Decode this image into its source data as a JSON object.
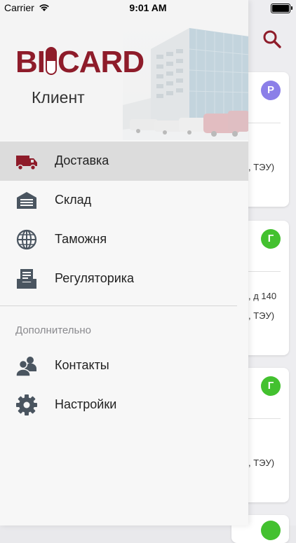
{
  "status_bar": {
    "carrier": "Carrier",
    "time": "9:01 AM"
  },
  "drawer": {
    "logo_text_left": "BI",
    "logo_text_right": "CARD",
    "subtitle": "Клиент",
    "items": [
      {
        "label": "Доставка",
        "icon": "truck-icon",
        "active": true
      },
      {
        "label": "Склад",
        "icon": "warehouse-icon",
        "active": false
      },
      {
        "label": "Таможня",
        "icon": "globe-icon",
        "active": false
      },
      {
        "label": "Регуляторика",
        "icon": "inbox-document-icon",
        "active": false
      }
    ],
    "section_title": "Дополнительно",
    "extra_items": [
      {
        "label": "Контакты",
        "icon": "contacts-icon"
      },
      {
        "label": "Настройки",
        "icon": "gear-icon"
      }
    ]
  },
  "cards": [
    {
      "badge": "Р",
      "badge_color": "#8b7fe8",
      "line1": "",
      "line2": ", ТЭУ)"
    },
    {
      "badge": "Г",
      "badge_color": "#43c12f",
      "line1": ", д 140",
      "line2": ", ТЭУ)"
    },
    {
      "badge": "Г",
      "badge_color": "#43c12f",
      "line1": "",
      "line2": ", ТЭУ)"
    }
  ],
  "colors": {
    "brand": "#8e1c2a",
    "active_item_bg": "#dcdcdc"
  }
}
